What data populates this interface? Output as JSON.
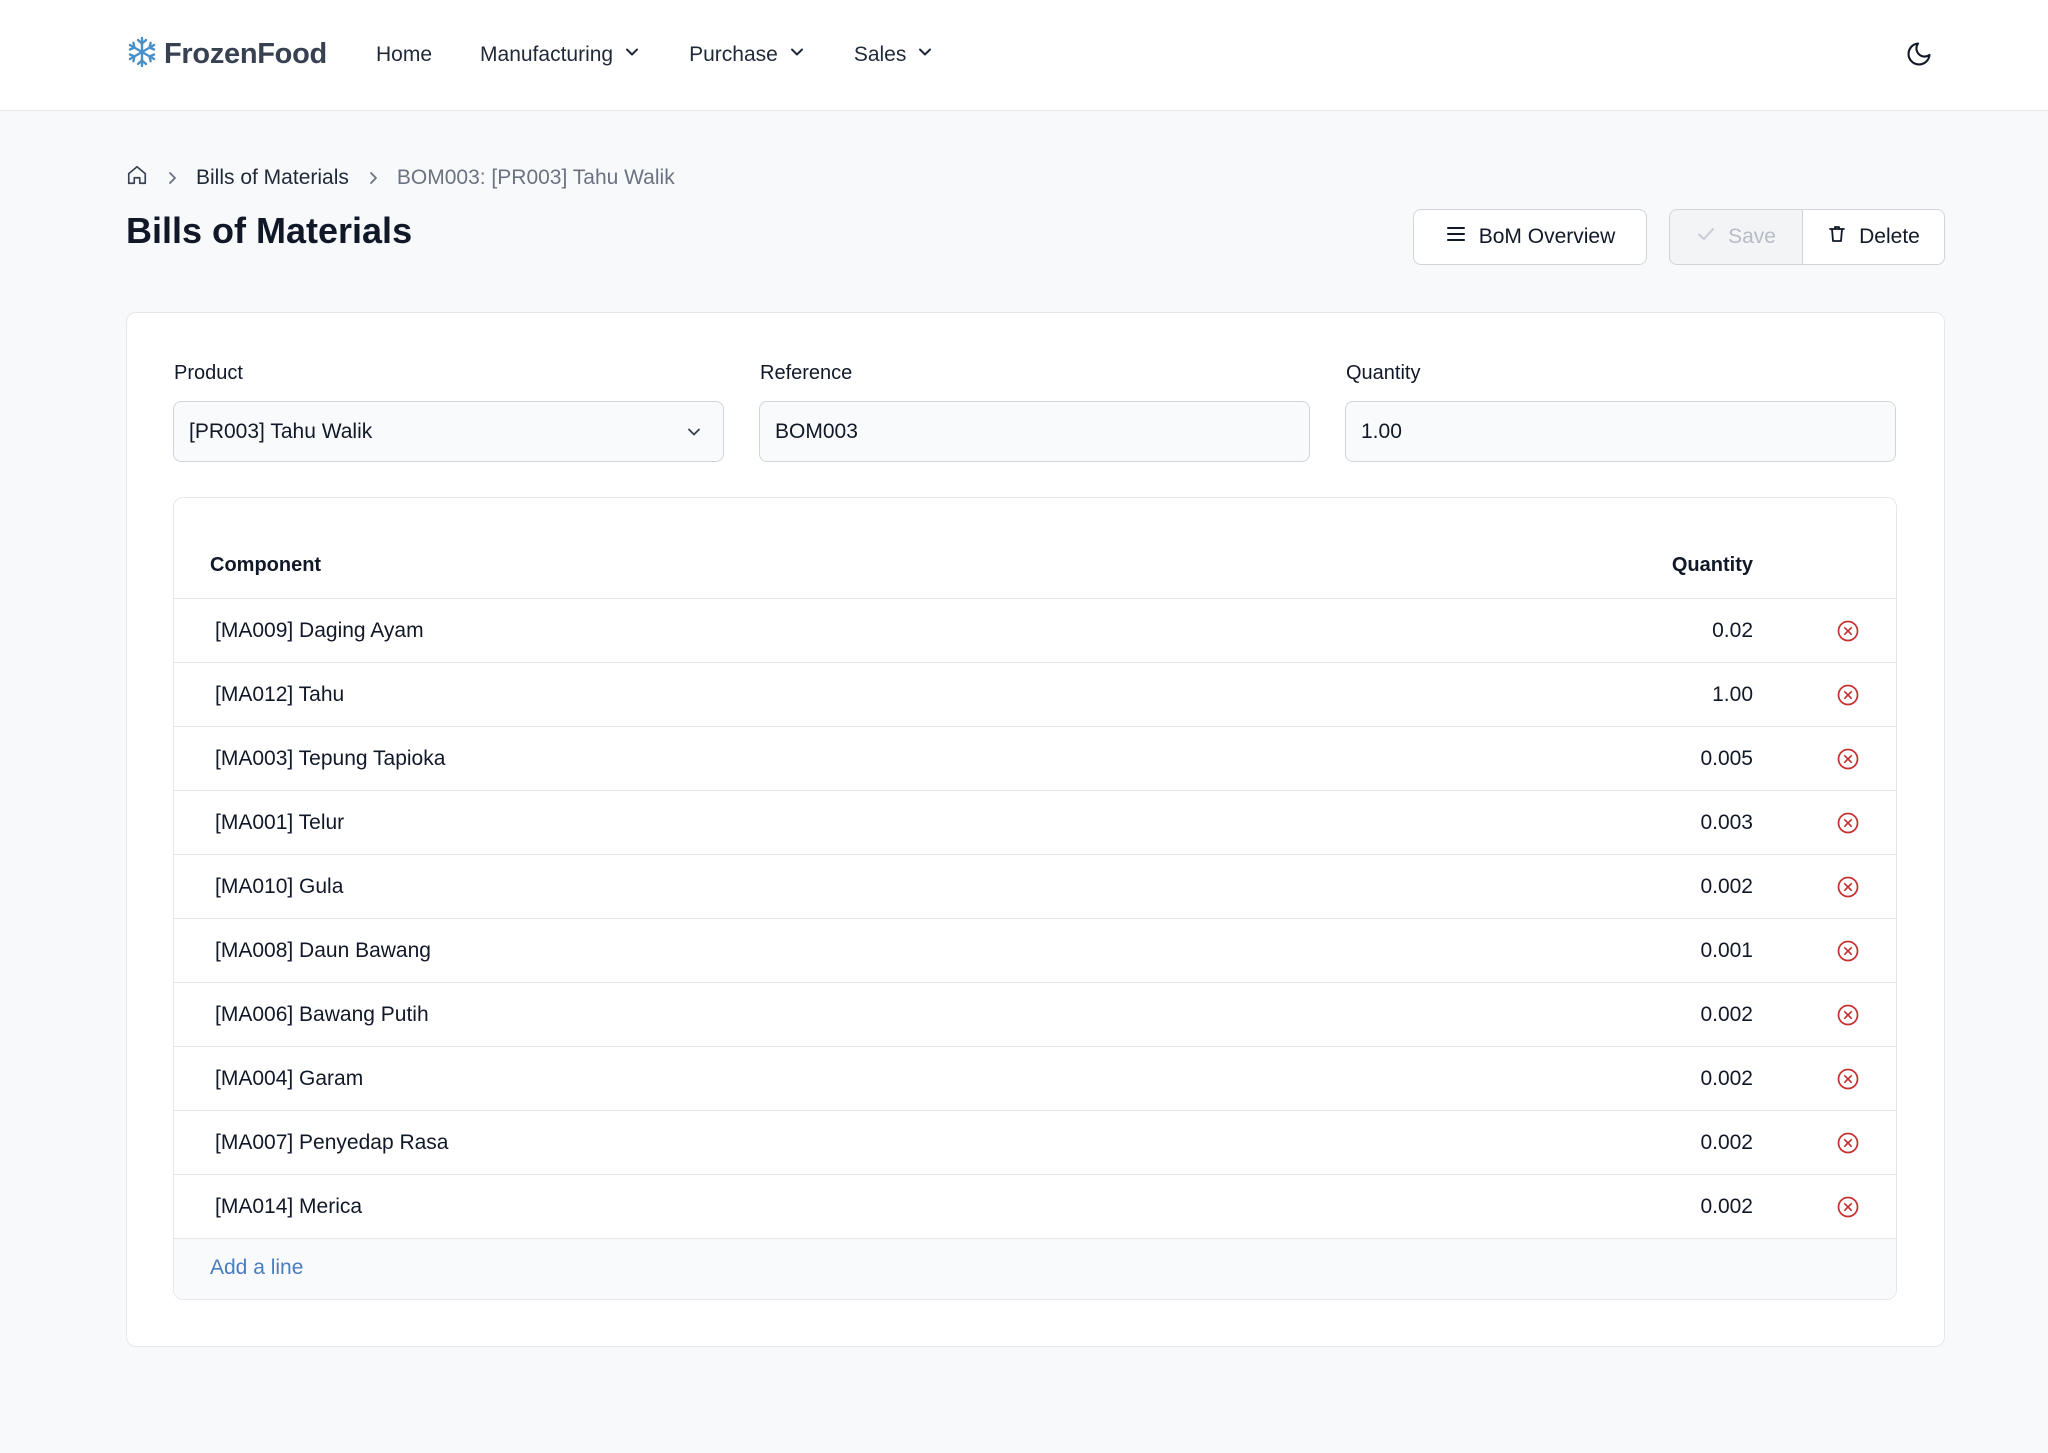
{
  "app": {
    "name": "FrozenFood"
  },
  "nav": {
    "items": [
      {
        "label": "Home",
        "dropdown": false
      },
      {
        "label": "Manufacturing",
        "dropdown": true
      },
      {
        "label": "Purchase",
        "dropdown": true
      },
      {
        "label": "Sales",
        "dropdown": true
      }
    ]
  },
  "breadcrumb": {
    "link": "Bills of Materials",
    "current": "BOM003: [PR003] Tahu Walik"
  },
  "page": {
    "title": "Bills of Materials"
  },
  "actions": {
    "overview_label": "BoM Overview",
    "save_label": "Save",
    "save_enabled": false,
    "delete_label": "Delete"
  },
  "form": {
    "product_label": "Product",
    "product_value": "[PR003] Tahu Walik",
    "reference_label": "Reference",
    "reference_value": "BOM003",
    "quantity_label": "Quantity",
    "quantity_value": "1.00"
  },
  "components": {
    "headers": {
      "component": "Component",
      "quantity": "Quantity"
    },
    "rows": [
      {
        "component": "[MA009] Daging Ayam",
        "quantity": "0.02"
      },
      {
        "component": "[MA012] Tahu",
        "quantity": "1.00"
      },
      {
        "component": "[MA003] Tepung Tapioka",
        "quantity": "0.005"
      },
      {
        "component": "[MA001] Telur",
        "quantity": "0.003"
      },
      {
        "component": "[MA010] Gula",
        "quantity": "0.002"
      },
      {
        "component": "[MA008] Daun Bawang",
        "quantity": "0.001"
      },
      {
        "component": "[MA006] Bawang Putih",
        "quantity": "0.002"
      },
      {
        "component": "[MA004] Garam",
        "quantity": "0.002"
      },
      {
        "component": "[MA007] Penyedap Rasa",
        "quantity": "0.002"
      },
      {
        "component": "[MA014] Merica",
        "quantity": "0.002"
      }
    ],
    "add_line_label": "Add a line"
  },
  "icons": {
    "logo": "snowflake-icon",
    "nav_dropdown": "chevron-down-icon",
    "theme": "moon-icon",
    "home": "home-icon",
    "breadcrumb_sep": "chevron-right-icon",
    "overview": "menu-icon",
    "save": "check-icon",
    "delete": "trash-icon",
    "row_delete": "x-circle-icon",
    "select": "chevron-down-icon"
  },
  "colors": {
    "brand": "#4a90c8",
    "link": "#4a7cc0",
    "danger": "#c53030",
    "disabled_text": "#b6bcc6"
  }
}
